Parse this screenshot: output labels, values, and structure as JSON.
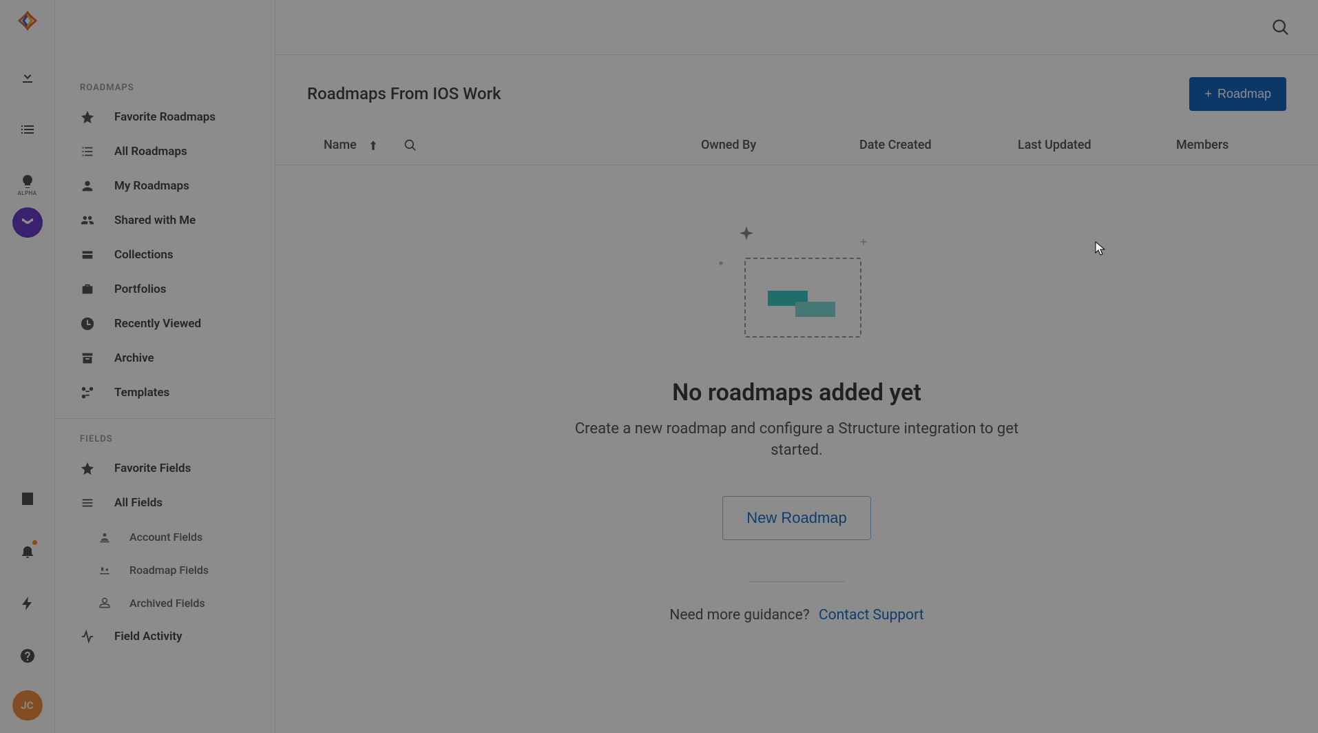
{
  "rail": {
    "alpha_label": "ALPHA"
  },
  "avatar": {
    "initials": "JC"
  },
  "sidebar": {
    "section_roadmaps": "ROADMAPS",
    "section_fields": "FIELDS",
    "items": [
      {
        "label": "Favorite Roadmaps"
      },
      {
        "label": "All Roadmaps"
      },
      {
        "label": "My Roadmaps"
      },
      {
        "label": "Shared with Me"
      },
      {
        "label": "Collections"
      },
      {
        "label": "Portfolios"
      },
      {
        "label": "Recently Viewed"
      },
      {
        "label": "Archive"
      },
      {
        "label": "Templates"
      }
    ],
    "fields_items": [
      {
        "label": "Favorite Fields"
      },
      {
        "label": "All Fields"
      }
    ],
    "fields_sub": [
      {
        "label": "Account Fields"
      },
      {
        "label": "Roadmap Fields"
      },
      {
        "label": "Archived Fields"
      }
    ],
    "field_activity": "Field Activity"
  },
  "page": {
    "title": "Roadmaps From IOS Work",
    "new_btn": "Roadmap"
  },
  "table": {
    "name": "Name",
    "owned_by": "Owned By",
    "date_created": "Date Created",
    "last_updated": "Last Updated",
    "members": "Members"
  },
  "empty": {
    "title": "No roadmaps added yet",
    "desc": "Create a new roadmap and configure a Structure integration to get started.",
    "new_roadmap": "New Roadmap",
    "guidance": "Need more guidance?",
    "contact": "Contact Support"
  }
}
